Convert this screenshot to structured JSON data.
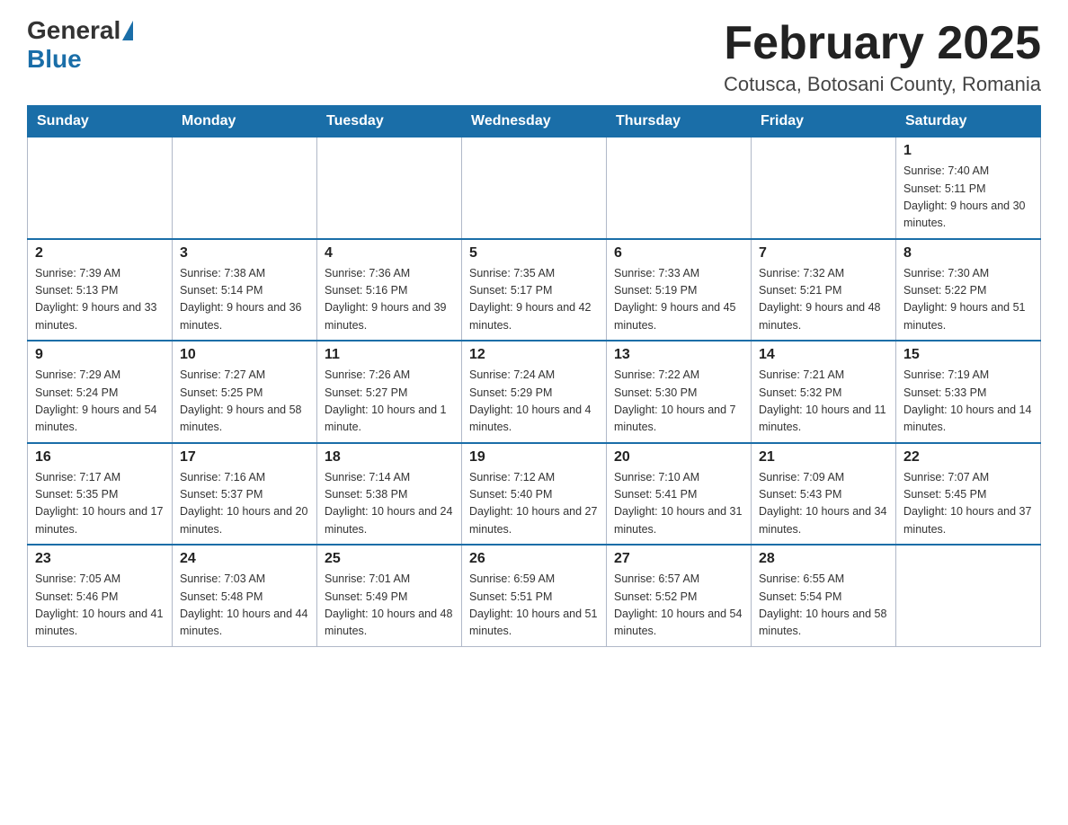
{
  "logo": {
    "general": "General",
    "blue": "Blue"
  },
  "header": {
    "title": "February 2025",
    "location": "Cotusca, Botosani County, Romania"
  },
  "weekdays": [
    "Sunday",
    "Monday",
    "Tuesday",
    "Wednesday",
    "Thursday",
    "Friday",
    "Saturday"
  ],
  "weeks": [
    [
      {
        "day": "",
        "info": ""
      },
      {
        "day": "",
        "info": ""
      },
      {
        "day": "",
        "info": ""
      },
      {
        "day": "",
        "info": ""
      },
      {
        "day": "",
        "info": ""
      },
      {
        "day": "",
        "info": ""
      },
      {
        "day": "1",
        "info": "Sunrise: 7:40 AM\nSunset: 5:11 PM\nDaylight: 9 hours and 30 minutes."
      }
    ],
    [
      {
        "day": "2",
        "info": "Sunrise: 7:39 AM\nSunset: 5:13 PM\nDaylight: 9 hours and 33 minutes."
      },
      {
        "day": "3",
        "info": "Sunrise: 7:38 AM\nSunset: 5:14 PM\nDaylight: 9 hours and 36 minutes."
      },
      {
        "day": "4",
        "info": "Sunrise: 7:36 AM\nSunset: 5:16 PM\nDaylight: 9 hours and 39 minutes."
      },
      {
        "day": "5",
        "info": "Sunrise: 7:35 AM\nSunset: 5:17 PM\nDaylight: 9 hours and 42 minutes."
      },
      {
        "day": "6",
        "info": "Sunrise: 7:33 AM\nSunset: 5:19 PM\nDaylight: 9 hours and 45 minutes."
      },
      {
        "day": "7",
        "info": "Sunrise: 7:32 AM\nSunset: 5:21 PM\nDaylight: 9 hours and 48 minutes."
      },
      {
        "day": "8",
        "info": "Sunrise: 7:30 AM\nSunset: 5:22 PM\nDaylight: 9 hours and 51 minutes."
      }
    ],
    [
      {
        "day": "9",
        "info": "Sunrise: 7:29 AM\nSunset: 5:24 PM\nDaylight: 9 hours and 54 minutes."
      },
      {
        "day": "10",
        "info": "Sunrise: 7:27 AM\nSunset: 5:25 PM\nDaylight: 9 hours and 58 minutes."
      },
      {
        "day": "11",
        "info": "Sunrise: 7:26 AM\nSunset: 5:27 PM\nDaylight: 10 hours and 1 minute."
      },
      {
        "day": "12",
        "info": "Sunrise: 7:24 AM\nSunset: 5:29 PM\nDaylight: 10 hours and 4 minutes."
      },
      {
        "day": "13",
        "info": "Sunrise: 7:22 AM\nSunset: 5:30 PM\nDaylight: 10 hours and 7 minutes."
      },
      {
        "day": "14",
        "info": "Sunrise: 7:21 AM\nSunset: 5:32 PM\nDaylight: 10 hours and 11 minutes."
      },
      {
        "day": "15",
        "info": "Sunrise: 7:19 AM\nSunset: 5:33 PM\nDaylight: 10 hours and 14 minutes."
      }
    ],
    [
      {
        "day": "16",
        "info": "Sunrise: 7:17 AM\nSunset: 5:35 PM\nDaylight: 10 hours and 17 minutes."
      },
      {
        "day": "17",
        "info": "Sunrise: 7:16 AM\nSunset: 5:37 PM\nDaylight: 10 hours and 20 minutes."
      },
      {
        "day": "18",
        "info": "Sunrise: 7:14 AM\nSunset: 5:38 PM\nDaylight: 10 hours and 24 minutes."
      },
      {
        "day": "19",
        "info": "Sunrise: 7:12 AM\nSunset: 5:40 PM\nDaylight: 10 hours and 27 minutes."
      },
      {
        "day": "20",
        "info": "Sunrise: 7:10 AM\nSunset: 5:41 PM\nDaylight: 10 hours and 31 minutes."
      },
      {
        "day": "21",
        "info": "Sunrise: 7:09 AM\nSunset: 5:43 PM\nDaylight: 10 hours and 34 minutes."
      },
      {
        "day": "22",
        "info": "Sunrise: 7:07 AM\nSunset: 5:45 PM\nDaylight: 10 hours and 37 minutes."
      }
    ],
    [
      {
        "day": "23",
        "info": "Sunrise: 7:05 AM\nSunset: 5:46 PM\nDaylight: 10 hours and 41 minutes."
      },
      {
        "day": "24",
        "info": "Sunrise: 7:03 AM\nSunset: 5:48 PM\nDaylight: 10 hours and 44 minutes."
      },
      {
        "day": "25",
        "info": "Sunrise: 7:01 AM\nSunset: 5:49 PM\nDaylight: 10 hours and 48 minutes."
      },
      {
        "day": "26",
        "info": "Sunrise: 6:59 AM\nSunset: 5:51 PM\nDaylight: 10 hours and 51 minutes."
      },
      {
        "day": "27",
        "info": "Sunrise: 6:57 AM\nSunset: 5:52 PM\nDaylight: 10 hours and 54 minutes."
      },
      {
        "day": "28",
        "info": "Sunrise: 6:55 AM\nSunset: 5:54 PM\nDaylight: 10 hours and 58 minutes."
      },
      {
        "day": "",
        "info": ""
      }
    ]
  ]
}
